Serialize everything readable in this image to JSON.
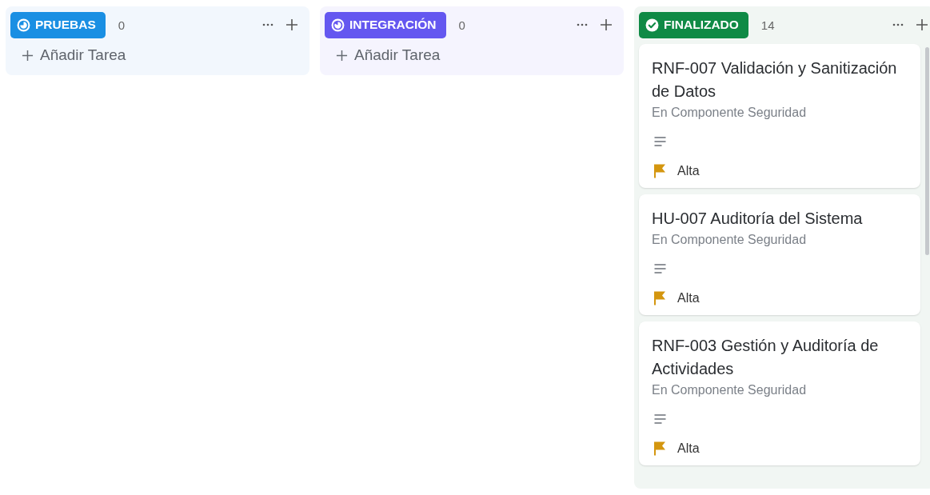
{
  "columns": [
    {
      "name": "PRUEBAS",
      "kind": "partial",
      "color": "#1a8fe3",
      "count": "0",
      "add_label": "Añadir Tarea"
    },
    {
      "name": "INTEGRACIÓN",
      "kind": "mostly",
      "color": "#6457f0",
      "count": "0",
      "add_label": "Añadir Tarea"
    },
    {
      "name": "FINALIZADO",
      "kind": "done",
      "color": "#0f8a45",
      "count": "14",
      "cards": [
        {
          "title": "RNF-007 Validación y Sanitización de Datos",
          "location": "En Componente Seguridad",
          "priority": "Alta"
        },
        {
          "title": "HU-007 Auditoría del Sistema",
          "location": "En Componente Seguridad",
          "priority": "Alta"
        },
        {
          "title": "RNF-003 Gestión y Auditoría de Actividades",
          "location": "En Componente Seguridad",
          "priority": "Alta"
        }
      ]
    }
  ]
}
